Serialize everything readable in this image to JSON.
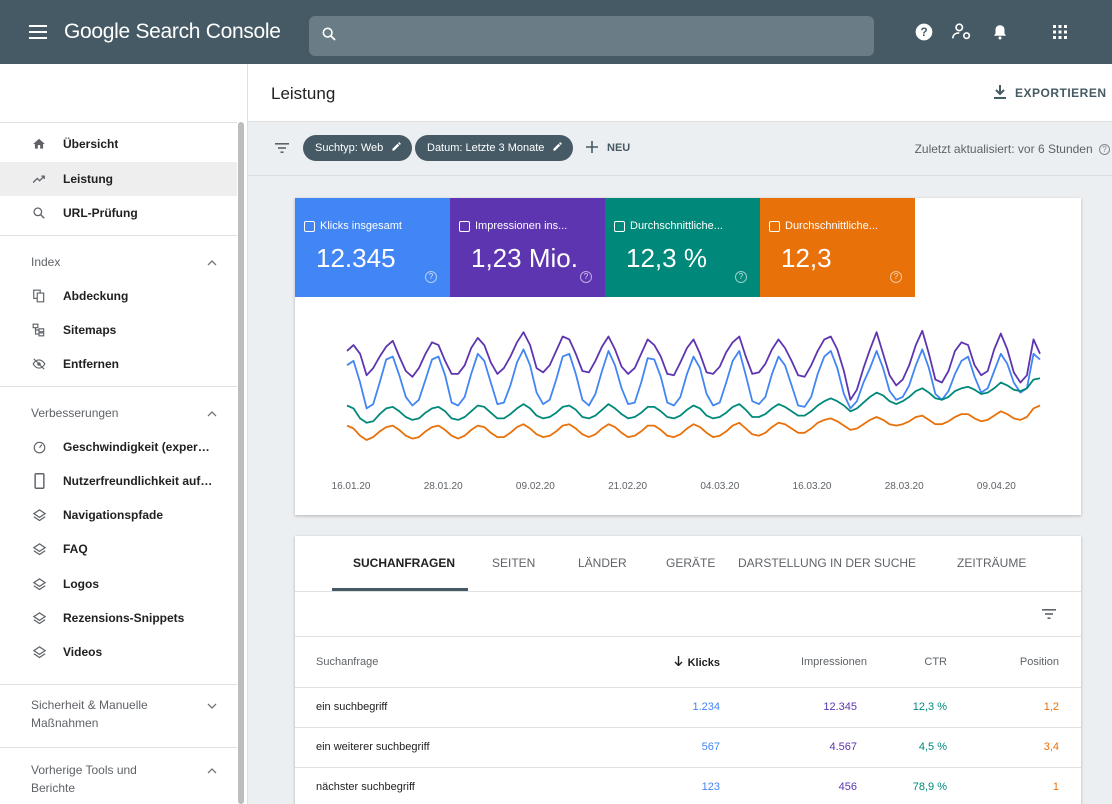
{
  "app": {
    "title": "Google Search Console"
  },
  "search": {
    "placeholder": ""
  },
  "header": {
    "title": "Leistung",
    "export_label": "EXPORTIEREN"
  },
  "sidebar": {
    "top_items": [
      {
        "label": "Übersicht",
        "icon": "home-icon"
      },
      {
        "label": "Leistung",
        "icon": "trending-up-icon",
        "active": true
      },
      {
        "label": "URL-Prüfung",
        "icon": "search-icon"
      }
    ],
    "sections": [
      {
        "title": "Index",
        "items": [
          {
            "label": "Abdeckung",
            "icon": "copy-icon"
          },
          {
            "label": "Sitemaps",
            "icon": "sitemap-icon"
          },
          {
            "label": "Entfernen",
            "icon": "visibility-off-icon"
          }
        ]
      },
      {
        "title": "Verbesserungen",
        "items": [
          {
            "label": "Geschwindigkeit (experimen...",
            "icon": "speed-icon"
          },
          {
            "label": "Nutzerfreundlichkeit auf Mo...",
            "icon": "phone-icon"
          },
          {
            "label": "Navigationspfade",
            "icon": "layers-icon"
          },
          {
            "label": "FAQ",
            "icon": "layers-icon"
          },
          {
            "label": "Logos",
            "icon": "layers-icon"
          },
          {
            "label": "Rezensions-Snippets",
            "icon": "layers-icon"
          },
          {
            "label": "Videos",
            "icon": "layers-icon"
          }
        ]
      },
      {
        "title": "Sicherheit & Manuelle Maßnahmen"
      },
      {
        "title": "Vorherige Tools und Berichte"
      }
    ]
  },
  "filters": {
    "chips": [
      "Suchtyp: Web",
      "Datum: Letzte 3 Monate"
    ],
    "new_label": "NEU",
    "updated": "Zuletzt aktualisiert: vor 6 Stunden"
  },
  "metrics": [
    {
      "label": "Klicks insgesamt",
      "value": "12.345",
      "color": "#4285f4"
    },
    {
      "label": "Impressionen ins...",
      "value": "1,23 Mio.",
      "color": "#5e35b1"
    },
    {
      "label": "Durchschnittliche...",
      "value": "12,3 %",
      "color": "#00897b"
    },
    {
      "label": "Durchschnittliche...",
      "value": "12,3",
      "color": "#e8710a"
    }
  ],
  "chart_data": {
    "type": "line",
    "x_ticks": [
      "16.01.20",
      "28.01.20",
      "09.02.20",
      "21.02.20",
      "04.03.20",
      "16.03.20",
      "28.03.20",
      "09.04.20"
    ],
    "grid": false,
    "series": [
      {
        "name": "Impressionen",
        "color": "#5e35b1",
        "values": [
          62,
          66,
          60,
          45,
          50,
          58,
          65,
          69,
          58,
          48,
          44,
          50,
          60,
          68,
          66,
          55,
          46,
          46,
          52,
          64,
          71,
          66,
          54,
          46,
          50,
          58,
          68,
          75,
          66,
          50,
          47,
          52,
          62,
          72,
          70,
          60,
          48,
          47,
          55,
          65,
          72,
          63,
          51,
          46,
          50,
          60,
          70,
          66,
          58,
          46,
          45,
          54,
          64,
          70,
          60,
          47,
          46,
          51,
          61,
          68,
          72,
          58,
          46,
          47,
          53,
          63,
          70,
          64,
          55,
          45,
          44,
          52,
          62,
          70,
          72,
          63,
          48,
          28,
          35,
          50,
          63,
          75,
          60,
          45,
          38,
          42,
          52,
          66,
          76,
          60,
          42,
          40,
          48,
          62,
          68,
          66,
          52,
          45,
          48,
          63,
          74,
          63,
          47,
          40,
          45,
          70,
          60
        ]
      },
      {
        "name": "Klicks",
        "color": "#4285f4",
        "values": [
          52,
          55,
          40,
          22,
          25,
          40,
          56,
          58,
          45,
          30,
          24,
          28,
          42,
          56,
          58,
          45,
          26,
          24,
          30,
          46,
          60,
          55,
          40,
          25,
          26,
          38,
          54,
          63,
          52,
          33,
          25,
          28,
          42,
          58,
          60,
          46,
          28,
          24,
          32,
          48,
          62,
          52,
          36,
          25,
          26,
          40,
          57,
          56,
          44,
          26,
          24,
          30,
          46,
          58,
          50,
          32,
          24,
          26,
          40,
          55,
          62,
          45,
          27,
          25,
          30,
          46,
          58,
          52,
          38,
          24,
          23,
          30,
          46,
          58,
          62,
          50,
          32,
          22,
          27,
          40,
          50,
          62,
          50,
          34,
          28,
          30,
          38,
          52,
          63,
          50,
          32,
          28,
          34,
          46,
          55,
          58,
          44,
          33,
          36,
          48,
          60,
          53,
          40,
          33,
          36,
          60,
          56
        ]
      },
      {
        "name": "CTR",
        "color": "#00897b",
        "values": [
          24,
          22,
          15,
          12,
          13,
          18,
          22,
          23,
          20,
          16,
          14,
          15,
          19,
          22,
          23,
          20,
          15,
          14,
          16,
          20,
          24,
          23,
          19,
          15,
          15,
          18,
          22,
          25,
          22,
          17,
          15,
          16,
          19,
          23,
          24,
          21,
          16,
          15,
          17,
          21,
          25,
          22,
          18,
          15,
          16,
          19,
          23,
          23,
          20,
          16,
          15,
          17,
          21,
          24,
          22,
          17,
          15,
          16,
          19,
          23,
          25,
          21,
          16,
          16,
          18,
          22,
          25,
          23,
          20,
          17,
          17,
          20,
          24,
          27,
          29,
          27,
          24,
          20,
          22,
          26,
          30,
          33,
          31,
          27,
          25,
          27,
          30,
          34,
          36,
          33,
          29,
          28,
          30,
          34,
          36,
          37,
          35,
          32,
          33,
          36,
          40,
          38,
          35,
          34,
          36,
          42,
          43
        ]
      },
      {
        "name": "Position",
        "color": "#e8710a",
        "values": [
          10,
          8,
          3,
          0,
          2,
          6,
          9,
          10,
          7,
          3,
          1,
          2,
          6,
          9,
          10,
          7,
          3,
          1,
          3,
          7,
          10,
          9,
          5,
          2,
          2,
          5,
          9,
          11,
          8,
          4,
          2,
          3,
          6,
          10,
          11,
          8,
          4,
          2,
          4,
          8,
          11,
          9,
          5,
          2,
          3,
          6,
          10,
          10,
          7,
          3,
          2,
          4,
          8,
          11,
          9,
          5,
          2,
          3,
          6,
          10,
          12,
          8,
          4,
          3,
          5,
          9,
          12,
          11,
          8,
          5,
          5,
          8,
          12,
          14,
          15,
          13,
          10,
          7,
          8,
          11,
          14,
          16,
          14,
          11,
          10,
          11,
          13,
          16,
          17,
          14,
          11,
          11,
          13,
          16,
          18,
          18,
          15,
          13,
          14,
          17,
          20,
          18,
          15,
          14,
          16,
          22,
          24
        ]
      }
    ]
  },
  "table": {
    "tabs": [
      "SUCHANFRAGEN",
      "SEITEN",
      "LÄNDER",
      "GERÄTE",
      "DARSTELLUNG IN DER SUCHE",
      "ZEITRÄUME"
    ],
    "headers": [
      "Suchanfrage",
      "Klicks",
      "Impressionen",
      "CTR",
      "Position"
    ],
    "rows": [
      [
        "ein suchbegriff",
        "1.234",
        "12.345",
        "12,3 %",
        "1,2"
      ],
      [
        "ein weiterer suchbegriff",
        "567",
        "4.567",
        "4,5 %",
        "3,4"
      ],
      [
        "nächster suchbegriff",
        "123",
        "456",
        "78,9 %",
        "1"
      ]
    ]
  }
}
